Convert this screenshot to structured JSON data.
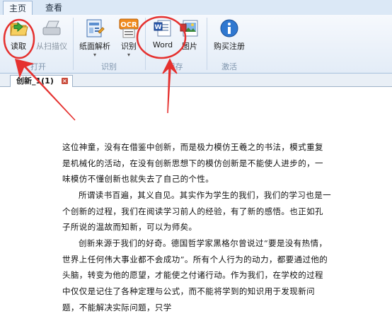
{
  "tabs": [
    {
      "label": "主页"
    },
    {
      "label": "查看"
    }
  ],
  "ribbon": {
    "read": "读取",
    "scan": "从扫描仪",
    "analyze": "纸面解析",
    "recognize": "识别",
    "word": "Word",
    "image": "图片",
    "buy": "购买注册",
    "groups": {
      "open": "打开",
      "recognize": "识别",
      "save": "保存",
      "activate": "激活"
    }
  },
  "doc_tab": {
    "label": "创新_1(1)"
  },
  "document": {
    "paragraphs": [
      "这位神童，没有在借鉴中创新，而是极力模仿王羲之的书法，模式重复是机械化的活动，在没有创新思想下的模仿创新是不能使人进步的，一味模仿不懂创新也就失去了自己的个性。",
      "所谓读书百遍，其义自见。其实作为学生的我们，我们的学习也是一个创新的过程，我们在阅读学习前人的经验，有了新的感悟。也正如孔子所说的温故而知新，可以为师矣。",
      "创新来源于我们的好奇。德国哲学家黑格尔曾说过“要是没有热情，世界上任何伟大事业都不会成功”。所有个人行为的动力，都要通过他的头脑，转变为他的愿望，才能使之付诸行动。作为我们，在学校的过程中仅仅是记住了各种定理与公式，而不能将学到的知识用于发现新问题，不能解决实际问题，只学"
    ]
  },
  "colors": {
    "annotation": "#e5312f",
    "ribbon_bg": "#e3ecf7"
  }
}
